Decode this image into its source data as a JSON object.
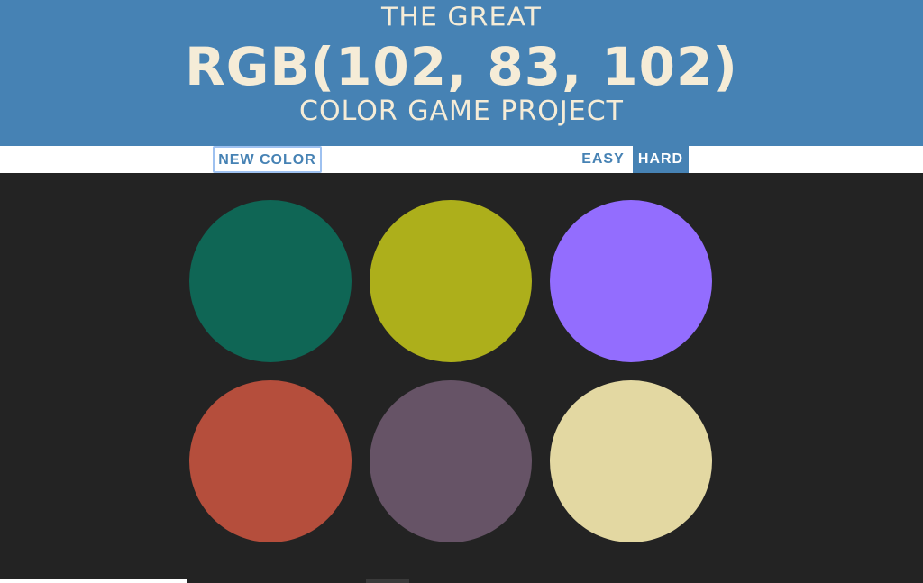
{
  "header": {
    "line1": "THE GREAT",
    "rgb_display": "RGB(102, 83, 102)",
    "line3": "COLOR GAME PROJECT",
    "background": "#4682b4",
    "text_color": "#f5ecd7"
  },
  "controls": {
    "new_color_label": "NEW COLOR",
    "easy_label": "EASY",
    "hard_label": "HARD",
    "selected_mode": "HARD"
  },
  "squares": [
    {
      "color": "#0f6655"
    },
    {
      "color": "#adaf1b"
    },
    {
      "color": "#936dfe"
    },
    {
      "color": "#b54e3c"
    },
    {
      "color": "#665366"
    },
    {
      "color": "#e3d8a2"
    }
  ],
  "background": "#232323"
}
